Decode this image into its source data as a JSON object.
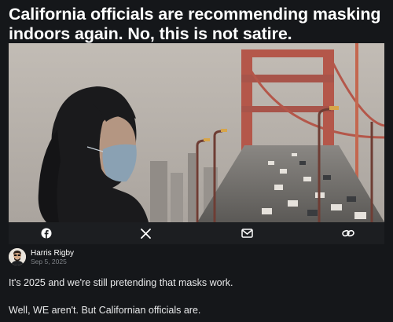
{
  "article": {
    "headline": "California officials are recommending masking indoors again. No, this is not satire.",
    "hero_image": "woman-in-face-mask-in-front-of-hazy-golden-gate-bridge-traffic"
  },
  "share_bar": {
    "buttons": [
      {
        "name": "facebook",
        "icon": "facebook-icon"
      },
      {
        "name": "x",
        "icon": "x-icon"
      },
      {
        "name": "email",
        "icon": "mail-icon"
      },
      {
        "name": "copy-link",
        "icon": "link-icon"
      }
    ]
  },
  "author": {
    "name": "Harris Rigby",
    "date": "Sep 5, 2025"
  },
  "body": {
    "paragraphs": [
      "It's 2025 and we're still pretending that masks work.",
      "Well, WE aren't. But Californian officials are."
    ]
  },
  "colors": {
    "background": "#15171a",
    "share_bar": "#1c1e21",
    "text": "#ffffff",
    "muted": "#7f8388",
    "bridge": "#b4574a"
  }
}
